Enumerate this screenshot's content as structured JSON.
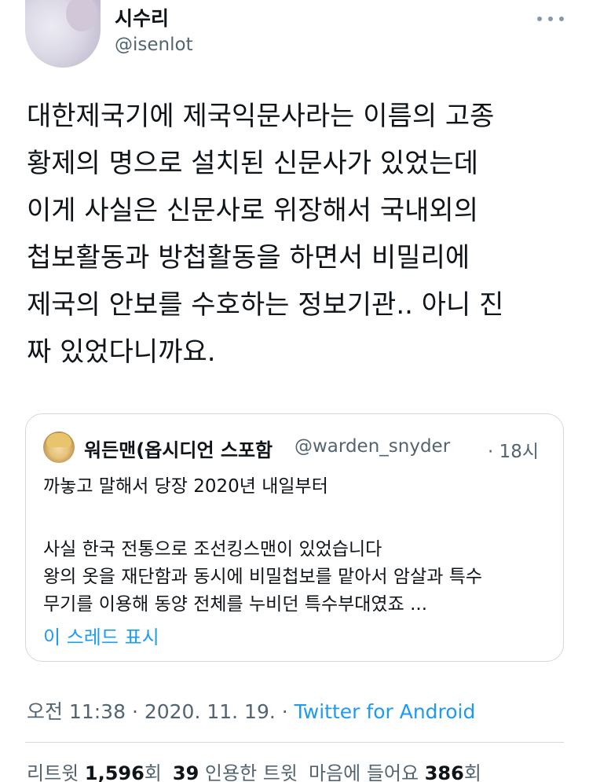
{
  "author": {
    "display_name": "시수리",
    "handle": "@isenlot"
  },
  "tweet": {
    "lines": [
      "대한제국기에 제국익문사라는 이름의 고종",
      "황제의 명으로 설치된 신문사가 있었는데",
      "이게 사실은 신문사로 위장해서 국내외의",
      "첩보활동과 방첩활동을 하면서 비밀리에",
      "제국의 안보를 수호하는 정보기관.. 아니 진",
      "짜 있었다니까요."
    ]
  },
  "quoted_tweet": {
    "display_name": "워든맨(옵시디언 스포함",
    "handle": "@warden_snyder",
    "time": "· 18시",
    "lines": [
      "까놓고 말해서 당장 2020년 내일부터",
      "사실 한국 전통으로 조선킹스맨이 있었습니다",
      "왕의 옷을 재단함과 동시에 비밀첩보를 맡아서 암살과 특수",
      "무기를 이용해 동양 전체를 누비던 특수부대였죠 ..."
    ],
    "show_thread": "이 스레드 표시"
  },
  "meta": {
    "timestamp": "오전 11:38 · 2020. 11. 19. · ",
    "source": "Twitter for Android"
  },
  "stats": {
    "retweets_label": "리트윗 ",
    "retweets_count": "1,596",
    "retweets_suffix": "회",
    "quotes_count": "39",
    "quotes_label": " 인용한 트윗",
    "likes_label": "마음에 들어요 ",
    "likes_count": "386",
    "likes_suffix": "회"
  },
  "icons": {
    "more": "more-horizontal-icon"
  },
  "colors": {
    "link": "#1d9bf0",
    "secondary_text": "#536471",
    "border": "#cfd9de"
  }
}
